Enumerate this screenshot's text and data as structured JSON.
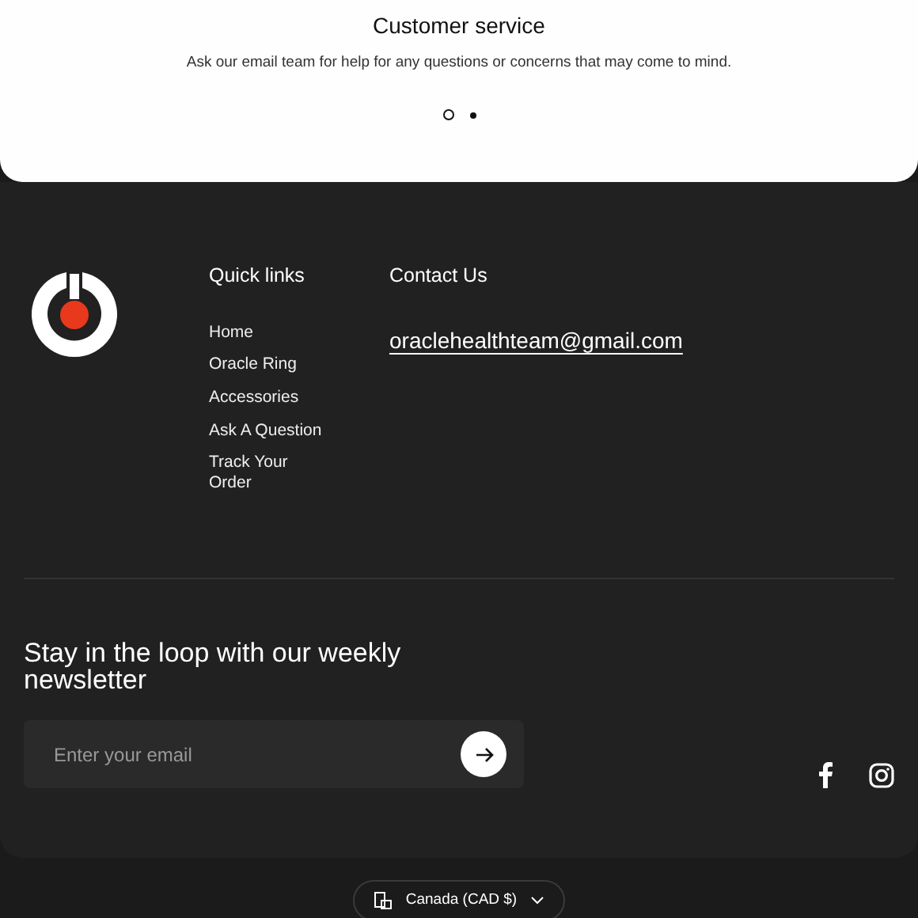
{
  "service": {
    "title": "Customer service",
    "text": "Ask our email team for help for any questions or concerns that may come to mind.",
    "dots": [
      {
        "selected": true
      },
      {
        "selected": false
      }
    ]
  },
  "quick_links": {
    "heading": "Quick links",
    "items": [
      "Home",
      "Oracle Ring",
      "Accessories",
      "Ask A Question",
      "Track Your Order"
    ]
  },
  "contact": {
    "heading": "Contact Us",
    "email": "oraclehealthteam@gmail.com"
  },
  "newsletter": {
    "heading": "Stay in the loop with our weekly newsletter",
    "placeholder": "Enter your email"
  },
  "country_selector": {
    "label": "Canada (CAD $)"
  }
}
